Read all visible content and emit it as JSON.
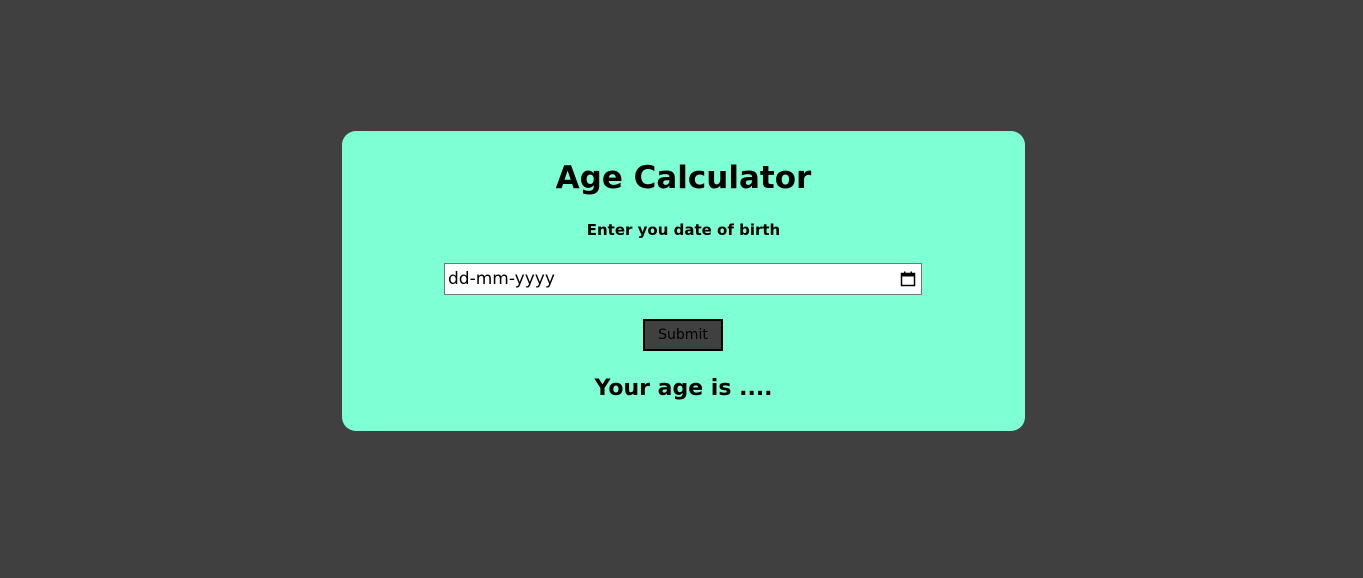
{
  "colors": {
    "page_background": "#404040",
    "card_background": "#7fffd4",
    "text": "#000000",
    "button_background": "#404040"
  },
  "card": {
    "title": "Age Calculator",
    "prompt": "Enter you date of birth",
    "date_input": {
      "placeholder": "dd-mm-yyyy",
      "icon": "calendar-icon"
    },
    "submit_label": "Submit",
    "result_text": "Your age is ...."
  }
}
